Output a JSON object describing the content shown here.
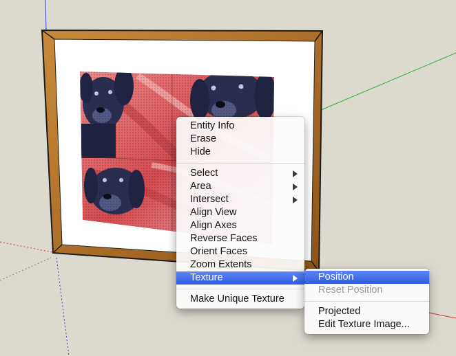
{
  "context_menu": {
    "items": [
      {
        "label": "Entity Info"
      },
      {
        "label": "Erase"
      },
      {
        "label": "Hide"
      },
      {
        "label": "Select"
      },
      {
        "label": "Area"
      },
      {
        "label": "Intersect"
      },
      {
        "label": "Align View"
      },
      {
        "label": "Align Axes"
      },
      {
        "label": "Reverse Faces"
      },
      {
        "label": "Orient Faces"
      },
      {
        "label": "Zoom Extents"
      },
      {
        "label": "Texture"
      },
      {
        "label": "Make Unique Texture"
      }
    ],
    "highlighted": "Texture"
  },
  "texture_submenu": {
    "items": [
      {
        "label": "Position",
        "state": "highlighted"
      },
      {
        "label": "Reset Position",
        "state": "disabled"
      },
      {
        "label": "Projected",
        "state": "enabled"
      },
      {
        "label": "Edit Texture Image...",
        "state": "enabled"
      }
    ]
  },
  "scene": {
    "background_color": "#dcd9cf",
    "axis_colors": {
      "red": "#d23030",
      "green": "#2fae2f",
      "blue": "#3a3ad8"
    },
    "frame_color": "#a8641e",
    "mat_color": "#ffffff",
    "texture_tint": "#e2575a",
    "dog_color": "#2a2f52",
    "menu_highlight": "#3b67ea",
    "icons": [
      "dog-texture-tile",
      "submenu-arrow"
    ]
  }
}
